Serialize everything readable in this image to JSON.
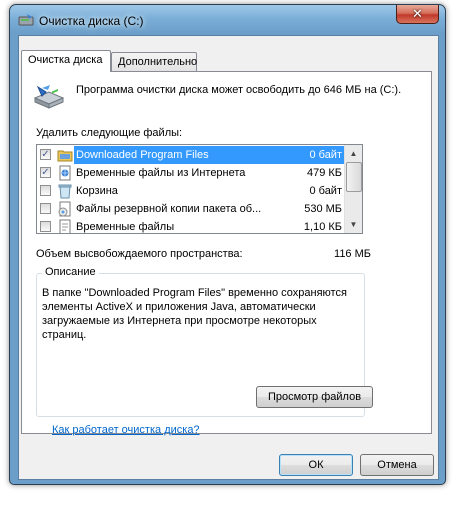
{
  "window": {
    "title": "Очистка диска  (C:)",
    "close_glyph": "✕"
  },
  "tabs": [
    {
      "label": "Очистка диска",
      "active": true
    },
    {
      "label": "Дополнительно",
      "active": false
    }
  ],
  "summary": "Программа очистки диска может освободить до 646 МБ на  (C:).",
  "files_label": "Удалить следующие файлы:",
  "files": [
    {
      "name": "Downloaded Program Files",
      "size": "0 байт",
      "checked": true,
      "selected": true,
      "icon": "folder-icon"
    },
    {
      "name": "Временные файлы из Интернета",
      "size": "479 КБ",
      "checked": true,
      "selected": false,
      "icon": "internet-files-icon"
    },
    {
      "name": "Корзина",
      "size": "0 байт",
      "checked": false,
      "selected": false,
      "icon": "recycle-bin-icon"
    },
    {
      "name": "Файлы резервной копии пакета об...",
      "size": "530 МБ",
      "checked": false,
      "selected": false,
      "icon": "backup-files-icon"
    },
    {
      "name": "Временные файлы",
      "size": "1,10 КБ",
      "checked": false,
      "selected": false,
      "icon": "temp-files-icon"
    }
  ],
  "freed": {
    "label": "Объем высвобождаемого пространства:",
    "value": "116 МБ"
  },
  "description": {
    "title": "Описание",
    "text": "В папке \"Downloaded Program Files\" временно сохраняются элементы ActiveX и приложения Java, автоматически загружаемые из Интернета при просмотре некоторых страниц."
  },
  "buttons": {
    "view_files": "Просмотр файлов",
    "ok": "ОК",
    "cancel": "Отмена"
  },
  "help_link": "Как работает очистка диска?"
}
